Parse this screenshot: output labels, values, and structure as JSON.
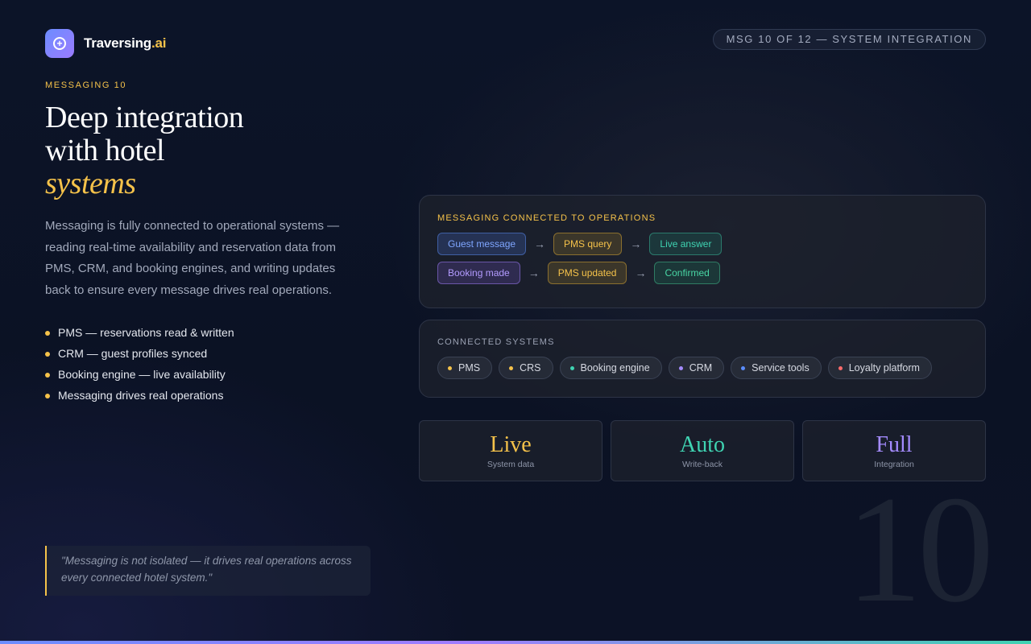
{
  "brand": {
    "name": "Traversing",
    "suffix": ".ai"
  },
  "badge": "MSG 10 OF 12 — SYSTEM INTEGRATION",
  "eyebrow": "MESSAGING 10",
  "headline": {
    "line1": "Deep integration",
    "line2": "with hotel",
    "accent": "systems"
  },
  "description": "Messaging is fully connected to operational systems — reading real-time availability and reservation data from PMS, CRM, and booking engines, and writing updates back to ensure every message drives real operations.",
  "bullets": [
    "PMS — reservations read & written",
    "CRM — guest profiles synced",
    "Booking engine — live availability",
    "Messaging drives real operations"
  ],
  "quote": "\"Messaging is not isolated — it drives real operations across every connected hotel system.\"",
  "operations": {
    "title": "MESSAGING CONNECTED TO OPERATIONS",
    "arrow": "→",
    "flow1": [
      "Guest message",
      "PMS query",
      "Live answer"
    ],
    "flow2": [
      "Booking made",
      "PMS updated",
      "Confirmed"
    ]
  },
  "systems": {
    "title": "CONNECTED SYSTEMS",
    "items": [
      {
        "label": "PMS",
        "color": "#f5c24a"
      },
      {
        "label": "CRS",
        "color": "#f5c24a"
      },
      {
        "label": "Booking engine",
        "color": "#3fd3b2"
      },
      {
        "label": "CRM",
        "color": "#a48bff"
      },
      {
        "label": "Service tools",
        "color": "#5b8dff"
      },
      {
        "label": "Loyalty platform",
        "color": "#ff6b6b"
      }
    ]
  },
  "stats": [
    {
      "value": "Live",
      "label": "System data",
      "color": "#f5c24a"
    },
    {
      "value": "Auto",
      "label": "Write-back",
      "color": "#3fd3b2"
    },
    {
      "value": "Full",
      "label": "Integration",
      "color": "#a48bff"
    }
  ],
  "big_number": "10"
}
